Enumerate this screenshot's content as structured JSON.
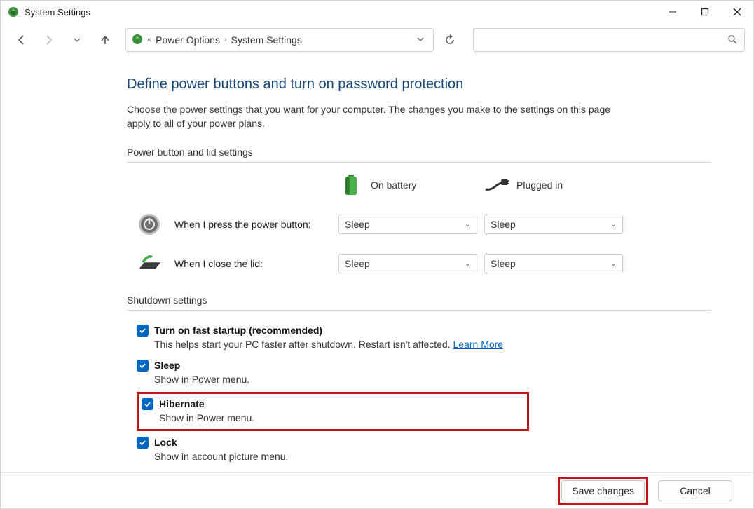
{
  "window": {
    "title": "System Settings"
  },
  "breadcrumb": {
    "prefix": "«",
    "items": [
      "Power Options",
      "System Settings"
    ]
  },
  "page": {
    "heading": "Define power buttons and turn on password protection",
    "description": "Choose the power settings that you want for your computer. The changes you make to the settings on this page apply to all of your power plans."
  },
  "sections": {
    "power_lid_label": "Power button and lid settings",
    "columns": {
      "battery": "On battery",
      "plugged": "Plugged in"
    },
    "rows": {
      "power_button": {
        "label": "When I press the power button:",
        "battery_value": "Sleep",
        "plugged_value": "Sleep"
      },
      "close_lid": {
        "label": "When I close the lid:",
        "battery_value": "Sleep",
        "plugged_value": "Sleep"
      }
    },
    "shutdown_label": "Shutdown settings",
    "shutdown_items": {
      "fast_startup": {
        "title": "Turn on fast startup (recommended)",
        "desc": "This helps start your PC faster after shutdown. Restart isn't affected. ",
        "learn_more": "Learn More",
        "checked": true
      },
      "sleep": {
        "title": "Sleep",
        "desc": "Show in Power menu.",
        "checked": true
      },
      "hibernate": {
        "title": "Hibernate",
        "desc": "Show in Power menu.",
        "checked": true
      },
      "lock": {
        "title": "Lock",
        "desc": "Show in account picture menu.",
        "checked": true
      }
    }
  },
  "footer": {
    "save": "Save changes",
    "cancel": "Cancel"
  }
}
